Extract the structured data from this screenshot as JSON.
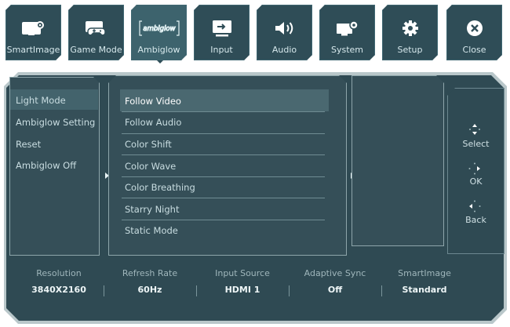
{
  "tabs": [
    {
      "label": "SmartImage",
      "icon": "smartimage-icon"
    },
    {
      "label": "Game Mode",
      "icon": "gamepad-icon"
    },
    {
      "label": "Ambiglow",
      "icon": "ambiglow-icon",
      "icon_text": "ambiglow",
      "active": true
    },
    {
      "label": "Input",
      "icon": "input-icon"
    },
    {
      "label": "Audio",
      "icon": "speaker-icon"
    },
    {
      "label": "System",
      "icon": "system-icon"
    },
    {
      "label": "Setup",
      "icon": "gear-icon"
    },
    {
      "label": "Close",
      "icon": "close-icon"
    }
  ],
  "left_menu": [
    "Light Mode",
    "Ambiglow Setting",
    "Reset",
    "Ambiglow Off"
  ],
  "left_selected": "Light Mode",
  "options": [
    "Follow Video",
    "Follow Audio",
    "Color Shift",
    "Color Wave",
    "Color Breathing",
    "Starry Night",
    "Static Mode"
  ],
  "option_selected": "Follow Video",
  "nav": {
    "select": "Select",
    "ok": "OK",
    "back": "Back"
  },
  "status": [
    {
      "title": "Resolution",
      "value": "3840X2160"
    },
    {
      "title": "Refresh Rate",
      "value": "60Hz"
    },
    {
      "title": "Input Source",
      "value": "HDMI 1"
    },
    {
      "title": "Adaptive Sync",
      "value": "Off"
    },
    {
      "title": "SmartImage",
      "value": "Standard"
    }
  ],
  "colors": {
    "panel": "#354f58",
    "frame": "#b9c7ca",
    "selected": "#4a6870",
    "text": "#c9dde1"
  }
}
